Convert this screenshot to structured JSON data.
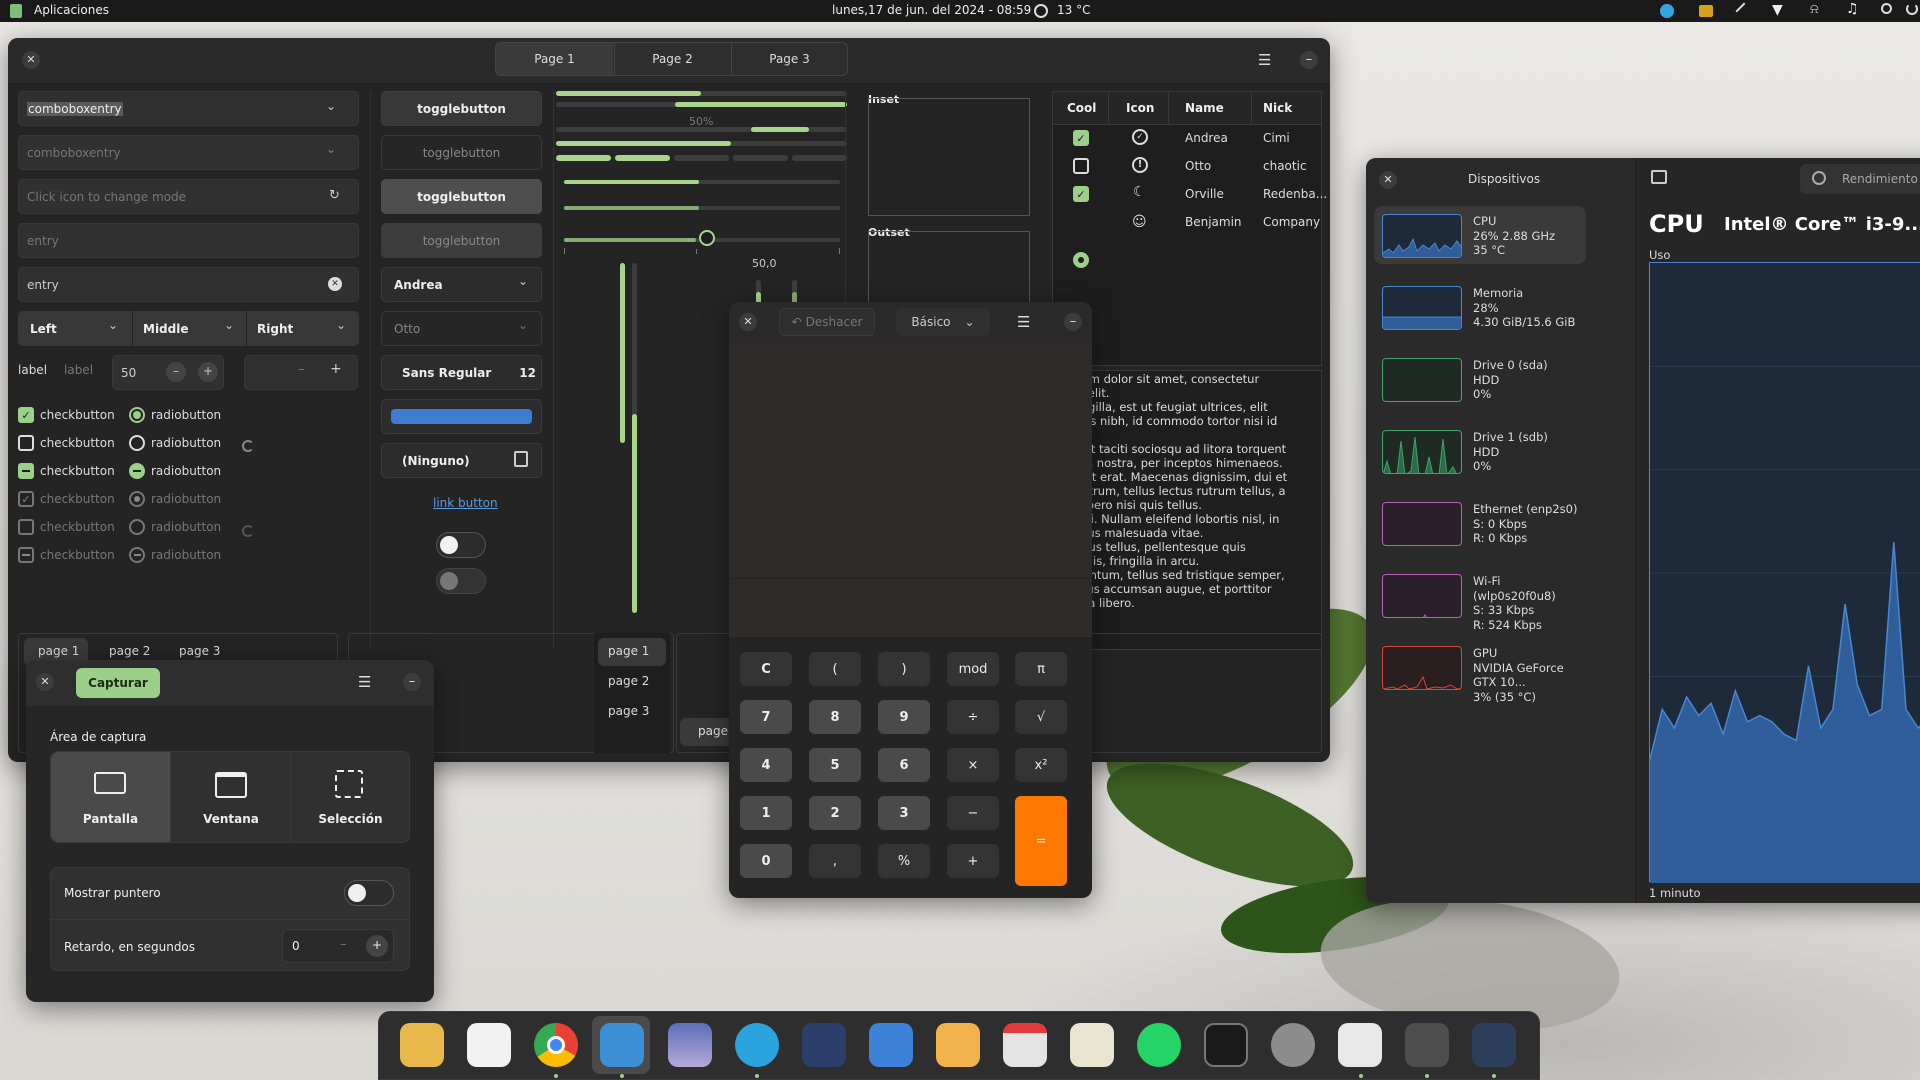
{
  "topbar": {
    "apps": "Aplicaciones",
    "datetime": "lunes,17 de jun. del 2024 - 08:59",
    "weather": "13 °C"
  },
  "widget_factory": {
    "tabs": [
      "Page 1",
      "Page 2",
      "Page 3"
    ],
    "combo1": "comboboxentry",
    "combo2": "comboboxentry",
    "entry_icon_placeholder": "Click icon to change mode",
    "entry_placeholder": "entry",
    "entry_value": "entry",
    "combos": [
      "Left",
      "Middle",
      "Right"
    ],
    "label1": "label",
    "label2": "label",
    "spin_value": "50",
    "checks": [
      "checkbutton",
      "checkbutton",
      "checkbutton",
      "checkbutton",
      "checkbutton",
      "checkbutton"
    ],
    "radios": [
      "radiobutton",
      "radiobutton",
      "radiobutton",
      "radiobutton",
      "radiobutton",
      "radiobutton"
    ],
    "toggles": [
      "togglebutton",
      "togglebutton",
      "togglebutton",
      "togglebutton"
    ],
    "dropdown1": "Andrea",
    "dropdown2": "Otto",
    "font_name": "Sans Regular",
    "font_size": "12",
    "file_chooser": "(Ninguno)",
    "link": "link button",
    "progress_label": "50%",
    "scale_value": "50,0",
    "frame_inset": "Inset",
    "frame_outset": "Outset",
    "tree_headers": [
      "Cool",
      "Icon",
      "Name",
      "Nick"
    ],
    "tree_rows": [
      {
        "cool": "check",
        "icon": "checkmark-circle-icon",
        "name": "Andrea",
        "nick": "Cimi"
      },
      {
        "cool": "empty",
        "icon": "warning-circle-icon",
        "name": "Otto",
        "nick": "chaotic"
      },
      {
        "cool": "check",
        "icon": "moon-icon",
        "name": "Orville",
        "nick": "Redenba..."
      },
      {
        "cool": "radio",
        "icon": "face-icon",
        "name": "Benjamin",
        "nick": "Company"
      }
    ],
    "lorem": "n ipsum dolor sit amet, consectetur\nscing elit.\nm fringilla, est ut feugiat ultrices, elit\nultrices nibh, id commodo tortor nisi id\n\n aptent taciti sociosqu ad litora torquent\nonubia nostra, per inceptos himenaeos.\n vel elit erat. Maecenas dignissim, dui et\nera rutrum, tellus lectus rutrum tellus, a\nallis libero nisi quis tellus.\n facilisi. Nullam eleifend lobortis nisl, in\nor tellus malesuada vitae.\nan lacus tellus, pellentesque quis\nstie quis, fringilla in arcu.\nelementum, tellus sed tristique semper,\ns metus accumsan augue, et porttitor\ns orci a libero.",
    "nb_tabs": [
      "page 1",
      "page 2",
      "page 3"
    ],
    "nb_vtabs": [
      "page 1",
      "page 2",
      "page 3"
    ],
    "nb_bottom_tab": "page"
  },
  "screenshot": {
    "capture_button": "Capturar",
    "area_label": "Área de captura",
    "modes": [
      {
        "label": "Pantalla",
        "icon": "monitor-icon"
      },
      {
        "label": "Ventana",
        "icon": "window-icon"
      },
      {
        "label": "Selección",
        "icon": "selection-icon"
      }
    ],
    "pointer_label": "Mostrar puntero",
    "delay_label": "Retardo, en segundos",
    "delay_value": "0"
  },
  "calculator": {
    "undo": "Deshacer",
    "mode": "Básico",
    "keys": [
      [
        "C",
        "(",
        ")",
        "mod",
        "π"
      ],
      [
        "7",
        "8",
        "9",
        "÷",
        "√"
      ],
      [
        "4",
        "5",
        "6",
        "×",
        "x²"
      ],
      [
        "1",
        "2",
        "3",
        "−",
        "="
      ],
      [
        "0",
        ",",
        "%",
        "+"
      ]
    ]
  },
  "monitor": {
    "title": "Dispositivos",
    "perf": "Rendimiento",
    "devices": [
      {
        "name": "CPU",
        "l2": "26% 2.88 GHz",
        "l3": "35 °C",
        "color": "#4a86d0"
      },
      {
        "name": "Memoria",
        "l2": "28%",
        "l3": "4.30 GiB/15.6 GiB",
        "color": "#4a86d0"
      },
      {
        "name": "Drive 0 (sda)",
        "l2": "HDD",
        "l3": "0%",
        "color": "#3fa36a"
      },
      {
        "name": "Drive 1 (sdb)",
        "l2": "HDD",
        "l3": "0%",
        "color": "#3fa36a"
      },
      {
        "name": "Ethernet (enp2s0)",
        "l2": "S: 0 Kbps",
        "l3": "R: 0 Kbps",
        "color": "#b65fb8"
      },
      {
        "name": "Wi-Fi (wlp0s20f0u8)",
        "l2": "S: 33 Kbps",
        "l3": "R: 524 Kbps",
        "color": "#b65fb8"
      },
      {
        "name": "GPU",
        "l2": "NVIDIA GeForce GTX 10...",
        "l3": "3% (35 °C)",
        "color": "#d5483e"
      }
    ],
    "cpu_title": "CPU",
    "cpu_model": "Intel® Core™ i3-9...",
    "usage": "Uso",
    "time": "1 minuto",
    "usage_series": [
      20,
      28,
      25,
      30,
      27,
      29,
      24,
      31,
      26,
      27,
      26,
      24,
      23,
      35,
      25,
      28,
      45,
      32,
      27,
      28,
      55,
      28,
      25,
      27,
      40,
      29,
      27
    ],
    "usage_series_color": "#4a86d0"
  },
  "dock": {
    "apps": [
      "files-icon",
      "software-icon",
      "chrome-icon",
      "screenshot-icon",
      "image-viewer-icon",
      "telegram-icon",
      "video-icon",
      "contacts-icon",
      "mail-icon",
      "calendar-icon",
      "text-editor-icon",
      "whatsapp-icon",
      "terminal-icon",
      "settings-icon",
      "system-monitor-icon",
      "calculator-icon",
      "resources-icon"
    ]
  }
}
